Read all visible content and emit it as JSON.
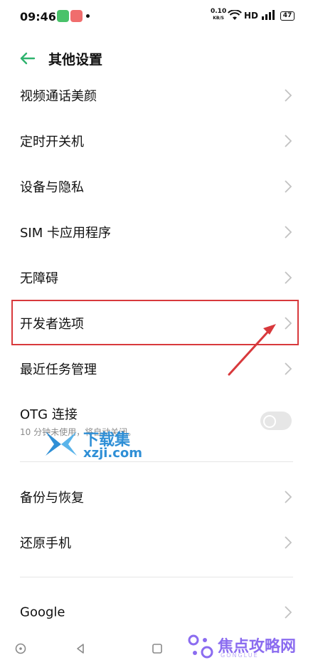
{
  "status_bar": {
    "time": "09:46",
    "net_speed_top": "0.10",
    "net_speed_unit": "KB/S",
    "hd": "HD",
    "battery": "47"
  },
  "header": {
    "title": "其他设置"
  },
  "items": [
    {
      "label": "视频通话美颜"
    },
    {
      "label": "定时开关机"
    },
    {
      "label": "设备与隐私"
    },
    {
      "label": "SIM 卡应用程序"
    },
    {
      "label": "无障碍"
    },
    {
      "label": "开发者选项"
    },
    {
      "label": "最近任务管理"
    }
  ],
  "otg": {
    "label": "OTG 连接",
    "desc": "10 分钟未使用，将自动关闭。",
    "enabled": false
  },
  "items2": [
    {
      "label": "备份与恢复"
    },
    {
      "label": "还原手机"
    }
  ],
  "items3": [
    {
      "label": "Google"
    }
  ],
  "watermarks": {
    "xz_title": "下载集",
    "xz_domain": "xzji.com",
    "jd_title": "焦点攻略网",
    "jd_sub": "GONGLUE"
  },
  "colors": {
    "accent": "#2fb36e",
    "highlight": "#d8393c",
    "toggle_off": "#e6e6e6"
  }
}
